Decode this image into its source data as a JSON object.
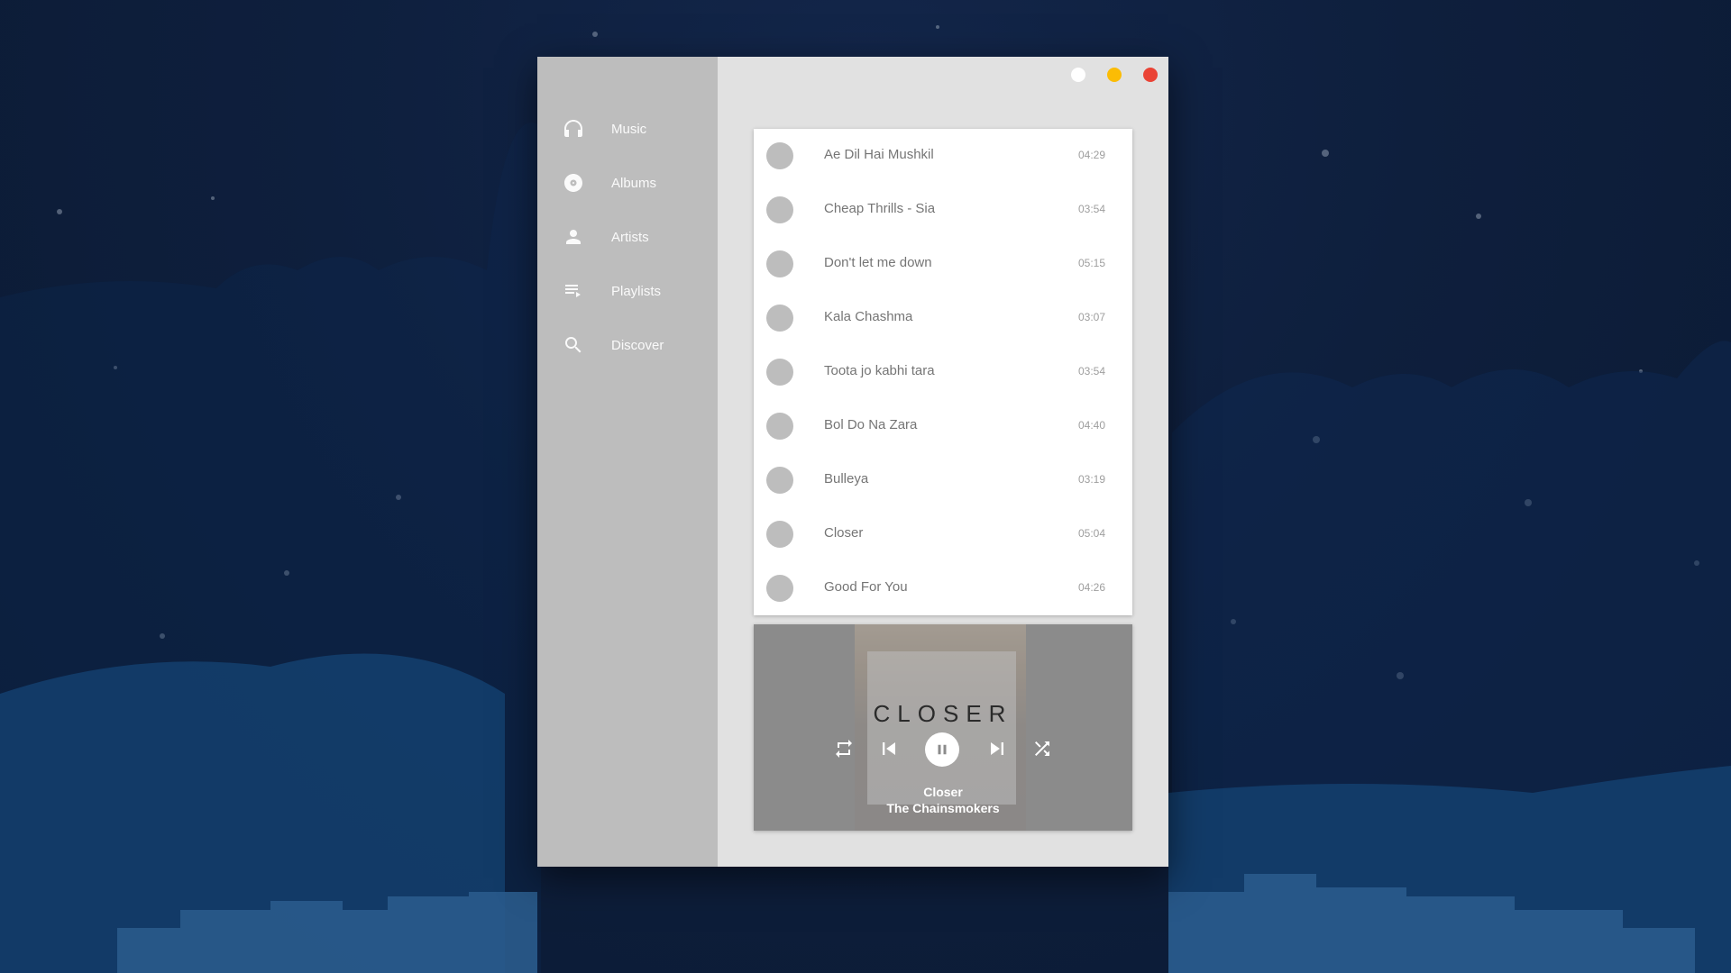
{
  "nav": {
    "items": [
      {
        "label": "Music",
        "icon": "headphones-icon"
      },
      {
        "label": "Albums",
        "icon": "album-icon"
      },
      {
        "label": "Artists",
        "icon": "person-icon"
      },
      {
        "label": "Playlists",
        "icon": "playlist-icon"
      },
      {
        "label": "Discover",
        "icon": "search-icon"
      }
    ]
  },
  "window_controls": {
    "colors": [
      "#ffffff",
      "#fbbc05",
      "#ea4335"
    ]
  },
  "tracks": [
    {
      "title": "Ae Dil Hai Mushkil",
      "duration": "04:29"
    },
    {
      "title": "Cheap Thrills - Sia",
      "duration": "03:54"
    },
    {
      "title": "Don't let me down",
      "duration": "05:15"
    },
    {
      "title": "Kala Chashma",
      "duration": "03:07"
    },
    {
      "title": "Toota jo kabhi tara",
      "duration": "03:54"
    },
    {
      "title": "Bol Do Na Zara",
      "duration": "04:40"
    },
    {
      "title": "Bulleya",
      "duration": "03:19"
    },
    {
      "title": "Closer",
      "duration": "05:04"
    },
    {
      "title": "Good For You",
      "duration": "04:26"
    }
  ],
  "player": {
    "cover_text": "CLOSER",
    "title": "Closer",
    "artist": "The Chainsmokers",
    "state": "playing"
  }
}
